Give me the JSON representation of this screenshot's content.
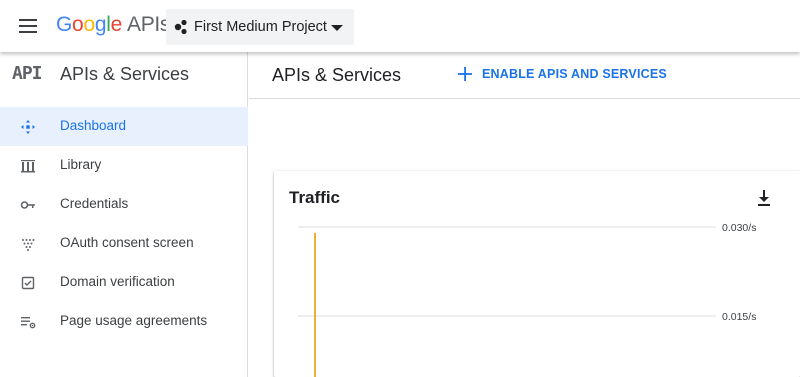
{
  "header": {
    "logo_google": "Google",
    "logo_apis": "APIs",
    "project_name": "First Medium Project"
  },
  "sidebar": {
    "section_mark": "API",
    "section_title": "APIs & Services",
    "items": [
      {
        "label": "Dashboard",
        "icon": "dashboard-icon",
        "active": true
      },
      {
        "label": "Library",
        "icon": "library-icon"
      },
      {
        "label": "Credentials",
        "icon": "key-icon"
      },
      {
        "label": "OAuth consent screen",
        "icon": "oauth-consent-icon"
      },
      {
        "label": "Domain verification",
        "icon": "domain-verification-icon"
      },
      {
        "label": "Page usage agreements",
        "icon": "page-usage-settings-icon"
      }
    ]
  },
  "main": {
    "title": "APIs & Services",
    "enable_label": "ENABLE APIS AND SERVICES"
  },
  "traffic_card": {
    "title": "Traffic",
    "chart_data": {
      "type": "line",
      "title": "Traffic",
      "y_tick_labels": [
        "0.030/s",
        "0.015/s"
      ],
      "y_ticks": [
        0.03,
        0.015
      ],
      "unit": "/s",
      "series": [
        {
          "color": "#f29900",
          "x": [
            0,
            0
          ],
          "y": [
            0.029,
            0
          ]
        }
      ]
    }
  },
  "colors": {
    "accent": "#1a73e8",
    "active_bg": "#e8f0fe",
    "series": "#f29900"
  }
}
